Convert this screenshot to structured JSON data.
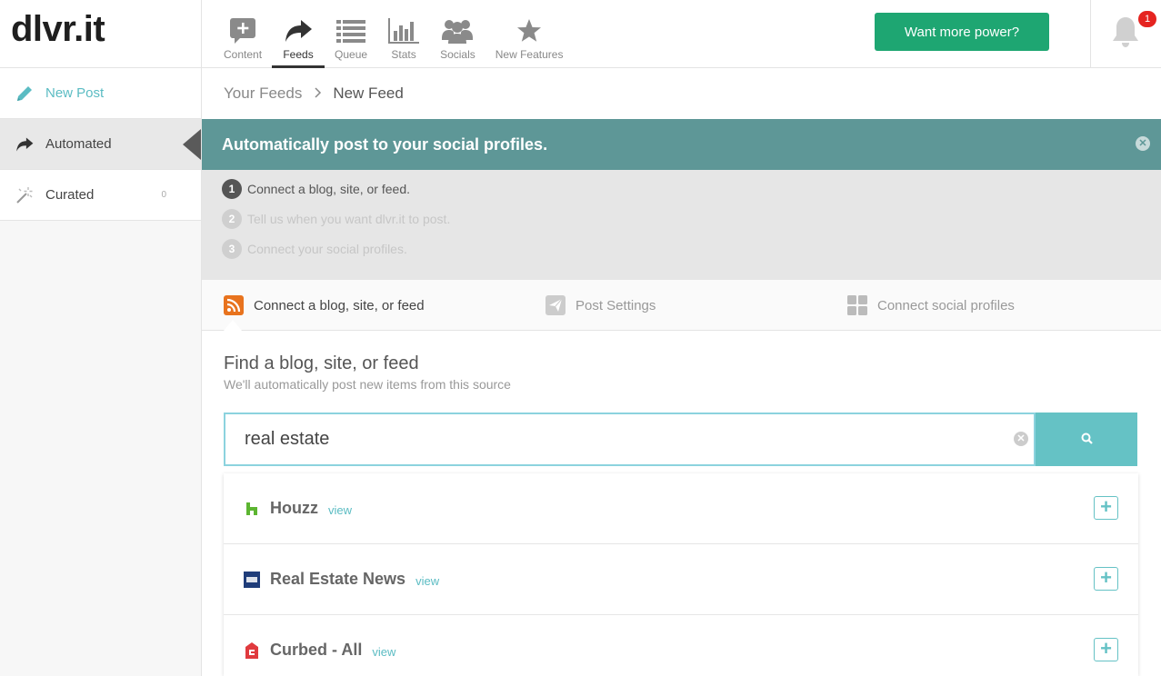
{
  "logo": {
    "text": "dlvr.it"
  },
  "nav": {
    "items": [
      {
        "label": "Content",
        "icon": "content-icon"
      },
      {
        "label": "Feeds",
        "icon": "share-icon"
      },
      {
        "label": "Queue",
        "icon": "list-icon"
      },
      {
        "label": "Stats",
        "icon": "bar-chart-icon"
      },
      {
        "label": "Socials",
        "icon": "users-icon"
      },
      {
        "label": "New Features",
        "icon": "star-icon"
      }
    ],
    "active": "Feeds"
  },
  "header": {
    "power_button": "Want more power?",
    "notifications_count": "1"
  },
  "sidebar": {
    "items": [
      {
        "label": "New Post",
        "icon": "pencil-icon"
      },
      {
        "label": "Automated",
        "icon": "share-icon"
      },
      {
        "label": "Curated",
        "icon": "magic-wand-icon",
        "count": "0"
      }
    ]
  },
  "breadcrumb": {
    "parent": "Your Feeds",
    "current": "New Feed"
  },
  "banner": {
    "title": "Automatically post to your social profiles."
  },
  "steps": [
    {
      "num": "1",
      "text": "Connect a blog, site, or feed."
    },
    {
      "num": "2",
      "text": "Tell us when you want dlvr.it to post."
    },
    {
      "num": "3",
      "text": "Connect your social profiles."
    }
  ],
  "tabs": [
    {
      "label": "Connect a blog, site, or feed",
      "icon": "rss-icon"
    },
    {
      "label": "Post Settings",
      "icon": "paper-plane-icon"
    },
    {
      "label": "Connect social profiles",
      "icon": "social-grid-icon"
    }
  ],
  "find": {
    "title": "Find a blog, site, or feed",
    "subtitle": "We'll automatically post new items from this source"
  },
  "search": {
    "value": "real estate"
  },
  "results": [
    {
      "name": "Houzz",
      "view": "view",
      "icon": "houzz-logo-icon"
    },
    {
      "name": "Real Estate News",
      "view": "view",
      "icon": "topix-logo-icon"
    },
    {
      "name": "Curbed - All",
      "view": "view",
      "icon": "curbed-logo-icon"
    }
  ],
  "colors": {
    "accent": "#5bbcc3",
    "banner": "#5e9797",
    "power_button": "#1ea672",
    "badge": "#e52420",
    "rss": "#e8731e"
  }
}
